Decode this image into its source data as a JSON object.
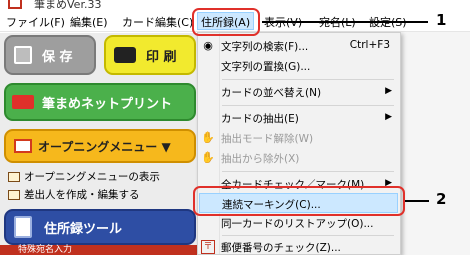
{
  "window": {
    "title": "筆まめVer.33"
  },
  "menubar": {
    "items": [
      "ファイル(F)",
      "編集(E)",
      "カード編集(C)",
      "住所録(A)",
      "表示(V)",
      "宛名(L)",
      "設定(S)"
    ]
  },
  "sidebar": {
    "save_label": "保 存",
    "print_label": "印 刷",
    "netprint_label": "筆まめネットプリント",
    "opening_label": "オープニングメニュー ▼",
    "list_items": [
      "オープニングメニューの表示",
      "差出人を作成・編集する"
    ],
    "address_tool_label": "住所録ツール",
    "bottom_partial": "特殊宛名入力"
  },
  "dropdown": {
    "items": [
      {
        "label": "文字列の検索(F)...",
        "shortcut": "Ctrl+F3",
        "icon": "binoculars-icon"
      },
      {
        "label": "文字列の置換(G)...",
        "icon": ""
      },
      {
        "label": "カードの並べ替え(N)",
        "submenu": true
      },
      {
        "label": "カードの抽出(E)",
        "submenu": true
      },
      {
        "label": "抽出モード解除(W)",
        "disabled": true,
        "icon": "hand-icon"
      },
      {
        "label": "抽出から除外(X)",
        "disabled": true,
        "icon": "hand-icon"
      },
      {
        "label": "全カードチェック／マーク(M)",
        "submenu": true
      },
      {
        "label": "連続マーキング(C)...",
        "highlighted": true
      },
      {
        "label": "同一カードのリストアップ(O)..."
      },
      {
        "label": "郵便番号のチェック(Z)...",
        "icon": "postal-icon"
      }
    ]
  },
  "callouts": {
    "one": "1",
    "two": "2"
  }
}
